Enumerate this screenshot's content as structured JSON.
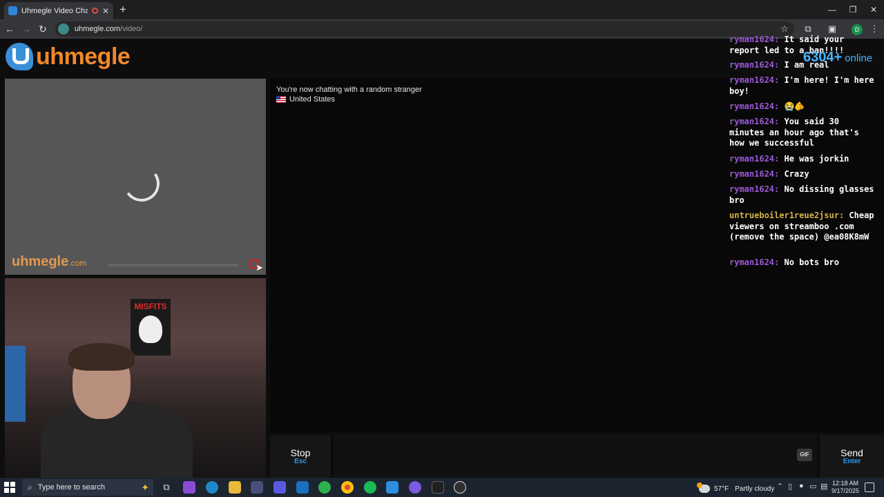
{
  "browser": {
    "tab_title": "Uhmegle Video Chat | Om...",
    "tab_close": "✕",
    "new_tab": "+",
    "url_host": "uhmegle.com",
    "url_path": "/video/",
    "controls": {
      "minimize": "—",
      "maximize": "❐",
      "close": "✕"
    },
    "nav": {
      "back": "←",
      "forward": "→",
      "reload": "↻"
    },
    "profile_initial": "D"
  },
  "site": {
    "logo_text": "uhmegle",
    "online_count": "6304+",
    "online_label": "online",
    "watermark_main": "uhmegle",
    "watermark_suffix": ".com",
    "accent": "#47b5ff",
    "brand": "#f0882a"
  },
  "chat": {
    "system_message": "You're now chatting with a random stranger",
    "country": "United States",
    "input_placeholder": "",
    "gif_label": "GIF",
    "stop": {
      "label": "Stop",
      "shortcut": "Esc"
    },
    "send": {
      "label": "Send",
      "shortcut": "Enter"
    }
  },
  "stream_chat": [
    {
      "user": "ryman1624:",
      "text": "It said your report led to a ban!!!!"
    },
    {
      "user": "ryman1624:",
      "text": "I am real"
    },
    {
      "user": "ryman1624:",
      "text": "I'm here! I'm here boy!"
    },
    {
      "user": "ryman1624:",
      "text": "😭🫵"
    },
    {
      "user": "ryman1624:",
      "text": "You said 30 minutes an hour ago that's how we successful"
    },
    {
      "user": "ryman1624:",
      "text": "He was jorkin"
    },
    {
      "user": "ryman1624:",
      "text": "Crazy"
    },
    {
      "user": "ryman1624:",
      "text": "No dissing glasses bro"
    },
    {
      "user": "untrueboiler1reue2jsur:",
      "text": "Cheap viewers on streamboo .com (remove the space) @ea08K8mW",
      "gold": true
    },
    {
      "user": "ryman1624:",
      "text": "No bots bro"
    }
  ],
  "taskbar": {
    "search_placeholder": "Type here to search",
    "weather_temp": "57°F",
    "weather_desc": "Partly cloudy",
    "time": "12:18 AM",
    "date": "9/17/2025"
  },
  "self_video": {
    "poster_text": "MISFITS"
  }
}
